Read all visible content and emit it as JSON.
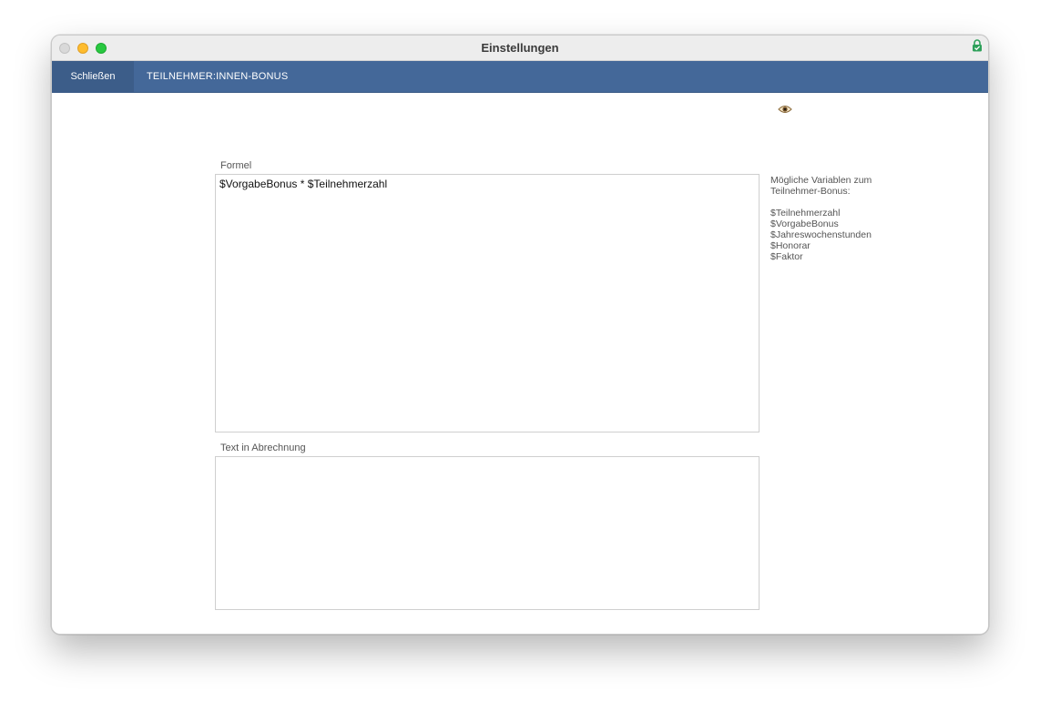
{
  "window": {
    "title": "Einstellungen"
  },
  "navbar": {
    "close_label": "Schließen",
    "title": "TEILNEHMER:INNEN-BONUS"
  },
  "form": {
    "formula_label": "Formel",
    "formula_value": "$VorgabeBonus * $Teilnehmerzahl",
    "text_label": "Text in Abrechnung",
    "text_value": ""
  },
  "hint": {
    "heading_line1": "Mögliche Variablen zum",
    "heading_line2": "Teilnehmer-Bonus:",
    "variables": [
      "$Teilnehmerzahl",
      "$VorgabeBonus",
      "$Jahreswochenstunden",
      "$Honorar",
      "$Faktor"
    ]
  },
  "icons": {
    "lock": "lock-icon",
    "eye": "eye-icon"
  },
  "colors": {
    "navbar": "#446899",
    "navbar_button": "#3c5d89",
    "lock": "#2ea05a"
  }
}
